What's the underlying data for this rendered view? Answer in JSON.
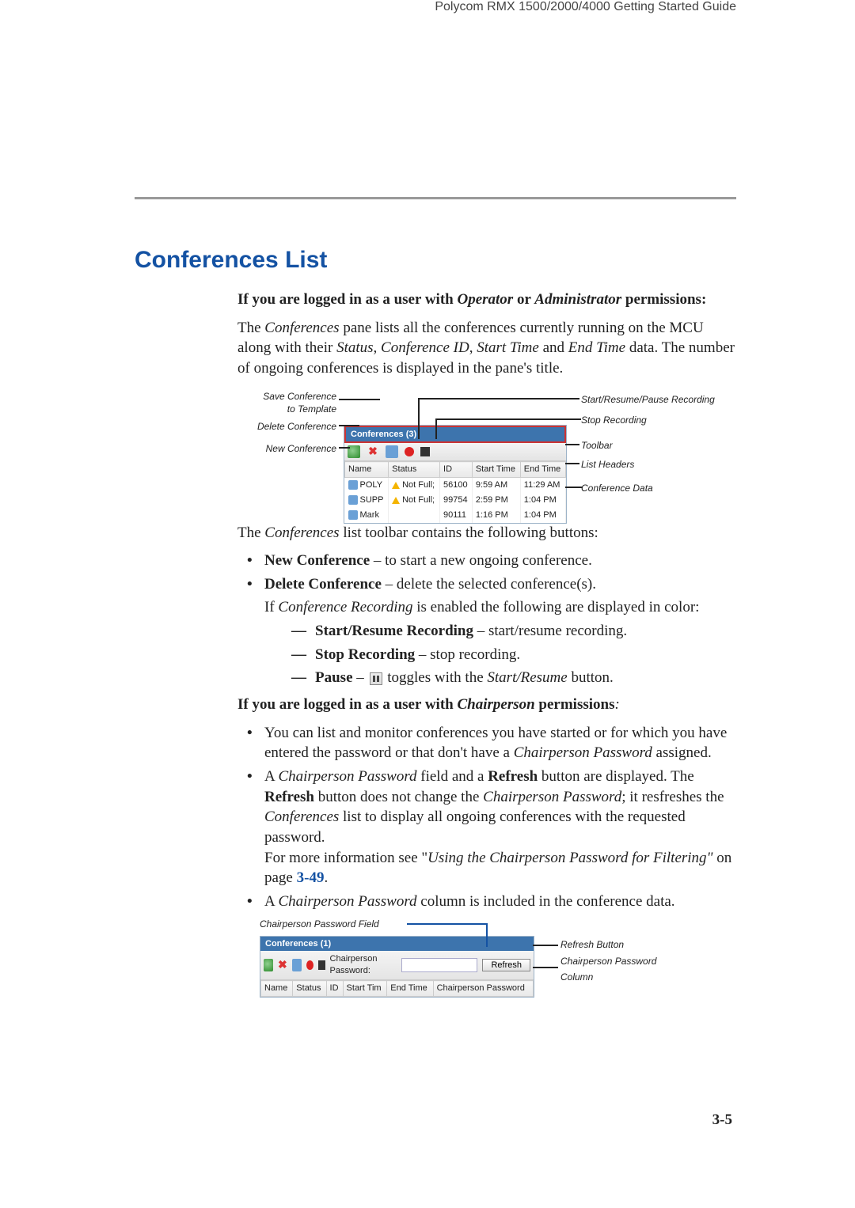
{
  "header": "Polycom RMX 1500/2000/4000 Getting Started Guide",
  "section_title": "Conferences List",
  "page_number": "3-5",
  "intro": {
    "line1_pre": "If you are logged in as a user with ",
    "line1_em1": "Operator",
    "line1_mid": " or ",
    "line1_em2": "Administrator",
    "line1_post": " permissions:",
    "para_pre": "The ",
    "para_em": "Conferences",
    "para_post": " pane lists all the conferences currently running on the MCU along with their ",
    "para_em2": "Status",
    "para_c1": ", ",
    "para_em3": "Conference ID",
    "para_c2": ", ",
    "para_em4": "Start Time",
    "para_c3": " and ",
    "para_em5": "End Time",
    "para_tail": " data. The number of ongoing conferences is displayed in the pane's title."
  },
  "figure1": {
    "labels_left": {
      "save1": "Save Conference",
      "save2": "to Template",
      "delete": "Delete Conference",
      "newconf": "New Conference"
    },
    "labels_right": {
      "r1": "Start/Resume/Pause Recording",
      "r2": "Stop Recording",
      "r3": "Toolbar",
      "r4": "List Headers",
      "r5": "Conference Data"
    },
    "pane_title": "Conferences (3)",
    "headers": {
      "c1": "Name",
      "c2": "Status",
      "c3": "ID",
      "c4": "Start Time",
      "c5": "End Time"
    },
    "rows": [
      {
        "name": "POLY",
        "status": "Not Full;",
        "id": "56100",
        "start": "9:59 AM",
        "end": "11:29 AM"
      },
      {
        "name": "SUPP",
        "status": "Not Full;",
        "id": "99754",
        "start": "2:59 PM",
        "end": "1:04 PM"
      },
      {
        "name": "Mark",
        "status": "",
        "id": "90111",
        "start": "1:16 PM",
        "end": "1:04 PM"
      }
    ]
  },
  "toolbar_sentence": {
    "pre": "The ",
    "em": "Conferences",
    "post": " list toolbar contains the following buttons:"
  },
  "bullets": {
    "newconf_b": "New Conference",
    "newconf_t": " – to start a new ongoing conference.",
    "delconf_b": "Delete Conference",
    "delconf_t": " – delete the selected conference(s).",
    "rec_pre": "If ",
    "rec_em": "Conference Recording",
    "rec_post": " is enabled the following are displayed in color:",
    "d1_b": "Start/Resume Recording",
    "d1_t": " – start/resume recording.",
    "d2_b": "Stop Recording",
    "d2_t": " – stop recording.",
    "d3_b": "Pause",
    "d3_mid": " – ",
    "d3_post1": " toggles with the ",
    "d3_em": "Start/Resume",
    "d3_post2": " button."
  },
  "chair_intro": {
    "pre": "If you are logged in as a user with ",
    "em": "Chairperson",
    "post": " permissions",
    "colon": ":"
  },
  "chair_bullets": {
    "b1_pre": "You can list and monitor conferences you have started or for which you have entered the password or that don't have a ",
    "b1_em": "Chairperson Password",
    "b1_post": " assigned.",
    "b2_pre": "A ",
    "b2_em1": "Chairperson Password",
    "b2_mid1": " field and a ",
    "b2_b1": "Refresh",
    "b2_mid2": " button are displayed. The ",
    "b2_b2": "Refresh",
    "b2_mid3": " button does not change the ",
    "b2_em2": "Chairperson Password",
    "b2_mid4": "; it resfreshes the ",
    "b2_em3": "Conferences",
    "b2_mid5": " list to display all ongoing conferences with the requested password.",
    "b2_more1": "For more information see \"",
    "b2_more_em": "Using the Chairperson Password for Filtering\"",
    "b2_more2": " on page ",
    "b2_link": "3-49",
    "b2_more3": ".",
    "b3_pre": "A ",
    "b3_em": "Chairperson Password",
    "b3_post": " column is included in the conference data."
  },
  "figure2": {
    "top_label": "Chairperson Password Field",
    "pane_title": "Conferences (1)",
    "cp_label": "Chairperson Password:",
    "refresh": "Refresh",
    "headers": {
      "c1": "Name",
      "c2": "Status",
      "c3": "ID",
      "c4": "Start Tim",
      "c5": "End Time",
      "c6": "Chairperson Password"
    },
    "right_labels": {
      "r1": "Refresh Button",
      "r2": "Chairperson Password",
      "r3": "Column"
    }
  }
}
